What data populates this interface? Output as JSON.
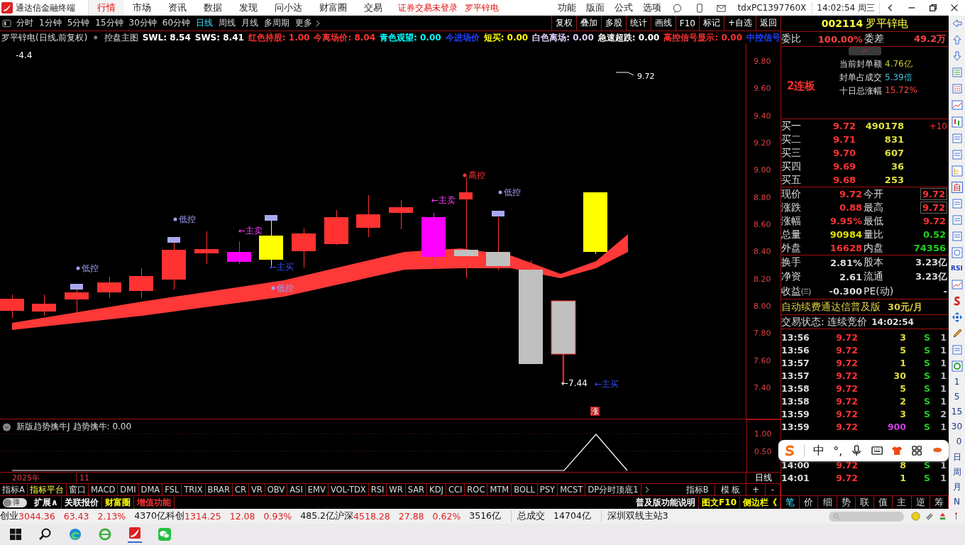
{
  "title_bar": {
    "app_name": "通达信金融终端",
    "menu": [
      {
        "label": "行情",
        "selected": true
      },
      {
        "label": "市场",
        "selected": false
      },
      {
        "label": "资讯",
        "selected": false
      },
      {
        "label": "数据",
        "selected": false
      },
      {
        "label": "发现",
        "selected": false
      },
      {
        "label": "问小达",
        "selected": false
      },
      {
        "label": "财富圈",
        "selected": false
      },
      {
        "label": "交易",
        "selected": false
      }
    ],
    "login_notice": "证券交易未登录",
    "stock_name": "罗平锌电",
    "right_menu": [
      "功能",
      "版面",
      "公式",
      "选项"
    ],
    "user": "tdxPC1397760X",
    "time": "14:02:54 周三"
  },
  "period_tabs": [
    {
      "label": "分时",
      "selected": false
    },
    {
      "label": "1分钟",
      "selected": false
    },
    {
      "label": "5分钟",
      "selected": false
    },
    {
      "label": "15分钟",
      "selected": false
    },
    {
      "label": "30分钟",
      "selected": false
    },
    {
      "label": "60分钟",
      "selected": false
    },
    {
      "label": "日线",
      "selected": true
    },
    {
      "label": "周线",
      "selected": false
    },
    {
      "label": "月线",
      "selected": false
    },
    {
      "label": "多周期",
      "selected": false
    },
    {
      "label": "更多",
      "selected": false
    }
  ],
  "chart_tools": [
    "复权",
    "叠加",
    "多股",
    "统计",
    "画线",
    "F10",
    "标记",
    "+自选",
    "返回"
  ],
  "indicator_line": {
    "title": "罗平锌电(日线,前复权)",
    "formula": "控盘主图",
    "values": [
      {
        "text": "SWL: 8.54",
        "color": "#ffffff"
      },
      {
        "text": "SWS: 8.41",
        "color": "#ffffff"
      },
      {
        "text": "红色持股: 1.00",
        "color": "#ff3232"
      },
      {
        "text": "今离场价: 8.04",
        "color": "#ff3232"
      },
      {
        "text": "青色观望: 0.00",
        "color": "#00ffff"
      },
      {
        "text": "今进场价",
        "color": "#2040ff"
      },
      {
        "text": "短买: 0.00",
        "color": "#ffff00"
      },
      {
        "text": "白色离场: 0.00",
        "color": "#e0d0ff"
      },
      {
        "text": "急速超跌: 0.00",
        "color": "#ffffff"
      },
      {
        "text": "高控信号显示: 0.00",
        "color": "#ff3232"
      },
      {
        "text": "中控信号",
        "color": "#2040ff"
      }
    ]
  },
  "price_ticks": [
    "9.80",
    "9.60",
    "9.40",
    "9.20",
    "9.00",
    "8.80",
    "8.60",
    "8.40",
    "8.20",
    "8.00",
    "7.80",
    "7.60",
    "7.40"
  ],
  "annotations": [
    {
      "text": "-4.4",
      "kind": "value"
    },
    {
      "text": "低控",
      "kind": "low-control"
    },
    {
      "text": "低控",
      "kind": "low-control"
    },
    {
      "text": "低控",
      "kind": "low-control"
    },
    {
      "text": "高控",
      "kind": "high-control"
    },
    {
      "text": "低控",
      "kind": "low-control"
    },
    {
      "text": "←主卖",
      "kind": "main-sell"
    },
    {
      "text": "←主卖",
      "kind": "main-sell"
    },
    {
      "text": "←主买",
      "kind": "main-buy"
    },
    {
      "text": "←主买",
      "kind": "main-buy"
    },
    {
      "text": "←7.44",
      "kind": "value"
    },
    {
      "text": "9.72",
      "kind": "high-mark"
    },
    {
      "text": "涨",
      "kind": "badge"
    }
  ],
  "sub_chart": {
    "title": "新版趋势擒牛J",
    "reading": "趋势擒牛: 0.00",
    "ticks": [
      "1.00",
      "0.50"
    ]
  },
  "date_axis": [
    "2025年",
    "11"
  ],
  "period_label": "日线",
  "indicator_tabs": [
    {
      "label": "指标A",
      "selected": false
    },
    {
      "label": "指标平台",
      "selected": true
    },
    {
      "label": "窗口",
      "selected": false
    },
    {
      "label": "MACD",
      "selected": false
    },
    {
      "label": "DMI",
      "selected": false
    },
    {
      "label": "DMA",
      "selected": false
    },
    {
      "label": "FSL",
      "selected": false
    },
    {
      "label": "TRIX",
      "selected": false
    },
    {
      "label": "BRAR",
      "selected": false
    },
    {
      "label": "CR",
      "selected": false
    },
    {
      "label": "VR",
      "selected": false
    },
    {
      "label": "OBV",
      "selected": false
    },
    {
      "label": "ASI",
      "selected": false
    },
    {
      "label": "EMV",
      "selected": false
    },
    {
      "label": "VOL-TDX",
      "selected": false
    },
    {
      "label": "RSI",
      "selected": false
    },
    {
      "label": "WR",
      "selected": false
    },
    {
      "label": "SAR",
      "selected": false
    },
    {
      "label": "KDJ",
      "selected": false
    },
    {
      "label": "CCI",
      "selected": false
    },
    {
      "label": "ROC",
      "selected": false
    },
    {
      "label": "MTM",
      "selected": false
    },
    {
      "label": "BOLL",
      "selected": false
    },
    {
      "label": "PSY",
      "selected": false
    },
    {
      "label": "MCST",
      "selected": false
    },
    {
      "label": "DP分时顶底1",
      "selected": false
    }
  ],
  "indicator_tabs_right": [
    "指标B",
    "模 板",
    "+",
    "-"
  ],
  "function_row": {
    "toggle_label": "弹",
    "toggle_on": false,
    "left": [
      {
        "text": "扩展∧",
        "color": "#ffffff"
      },
      {
        "text": "关联报价",
        "color": "#ffffff"
      },
      {
        "text": "财富圈",
        "color": "#ffff00"
      },
      {
        "text": "增值功能",
        "color": "#ff3232"
      }
    ],
    "right": [
      {
        "text": "普及版功能说明",
        "color": "#ffffff"
      },
      {
        "text": "图文F10",
        "color": "#ffff00"
      },
      {
        "text": "侧边栏《",
        "color": "#ffff00"
      }
    ]
  },
  "quote_panel": {
    "code": "002114",
    "name": "罗平锌电",
    "ratio": {
      "label": "委比",
      "value": "100.00%",
      "diff_label": "委差",
      "diff": "49.2万"
    },
    "seal": {
      "streak": "2连板",
      "lines": [
        {
          "label": "当前封单额",
          "value": "4.76亿",
          "color": "#c8c832"
        },
        {
          "label": "封单占成交",
          "value": "5.39倍",
          "color": "#40c0e0"
        },
        {
          "label": "十日总涨幅",
          "value": "15.72%",
          "color": "#ff4040"
        }
      ]
    },
    "bids": [
      {
        "label": "买一",
        "price": "9.72",
        "volume": "490178",
        "change": "+10"
      },
      {
        "label": "买二",
        "price": "9.71",
        "volume": "831"
      },
      {
        "label": "买三",
        "price": "9.70",
        "volume": "607"
      },
      {
        "label": "买四",
        "price": "9.69",
        "volume": "36"
      },
      {
        "label": "买五",
        "price": "9.68",
        "volume": "253"
      }
    ],
    "stats": [
      {
        "left": {
          "label": "现价",
          "value": "9.72",
          "color": "#ff3232"
        },
        "right": {
          "label": "今开",
          "value": "9.72",
          "color": "#ff3232",
          "boxed": true
        }
      },
      {
        "left": {
          "label": "涨跌",
          "value": "0.88",
          "color": "#ff3232"
        },
        "right": {
          "label": "最高",
          "value": "9.72",
          "color": "#ff3232",
          "boxed": true
        }
      },
      {
        "left": {
          "label": "涨幅",
          "value": "9.95%",
          "color": "#ff3232"
        },
        "right": {
          "label": "最低",
          "value": "9.72",
          "color": "#ff3232",
          "boxed": false
        }
      },
      {
        "left": {
          "label": "总量",
          "value": "90984",
          "color": "#e0e000"
        },
        "right": {
          "label": "量比",
          "value": "0.52",
          "color": "#20d020",
          "boxed": false
        }
      },
      {
        "left": {
          "label": "外盘",
          "value": "16628",
          "color": "#ff3232"
        },
        "right": {
          "label": "内盘",
          "value": "74356",
          "color": "#20d020",
          "boxed": false
        }
      }
    ],
    "fundamentals": [
      {
        "l1": "换手",
        "v1": "2.81%",
        "l2": "股本",
        "v2": "3.23亿"
      },
      {
        "l1": "净资",
        "v1": "2.61",
        "l2": "流通",
        "v2": "3.23亿"
      },
      {
        "l1": "收益㈢",
        "v1": "-0.300",
        "l2": "PE(动)",
        "v2": "-"
      }
    ],
    "ad": {
      "text": "自动续费通达信普及版",
      "price": "30元/月"
    },
    "trade_status": {
      "label": "交易状态: 连续竞价",
      "time": "14:02:54"
    },
    "ticks": [
      {
        "time": "13:56",
        "price": "9.72",
        "volume": "3",
        "side": "S",
        "count": "1",
        "large": false
      },
      {
        "time": "13:56",
        "price": "9.72",
        "volume": "5",
        "side": "S",
        "count": "1",
        "large": false
      },
      {
        "time": "13:57",
        "price": "9.72",
        "volume": "1",
        "side": "S",
        "count": "1",
        "large": false
      },
      {
        "time": "13:57",
        "price": "9.72",
        "volume": "30",
        "side": "S",
        "count": "1",
        "large": false
      },
      {
        "time": "13:58",
        "price": "9.72",
        "volume": "5",
        "side": "S",
        "count": "1",
        "large": false
      },
      {
        "time": "13:58",
        "price": "9.72",
        "volume": "2",
        "side": "S",
        "count": "1",
        "large": false
      },
      {
        "time": "13:59",
        "price": "9.72",
        "volume": "3",
        "side": "S",
        "count": "2",
        "large": false
      },
      {
        "time": "13:59",
        "price": "9.72",
        "volume": "900",
        "side": "S",
        "count": "1",
        "large": true
      },
      {
        "time": "14:00",
        "price": "9.72",
        "volume": "8",
        "side": "S",
        "count": "1",
        "large": false
      },
      {
        "time": "14:01",
        "price": "9.72",
        "volume": "1",
        "side": "S",
        "count": "1",
        "large": false
      }
    ],
    "tabs": [
      {
        "label": "笔",
        "selected": true
      },
      {
        "label": "价",
        "selected": false
      },
      {
        "label": "细",
        "selected": false
      },
      {
        "label": "势",
        "selected": false
      },
      {
        "label": "联",
        "selected": false
      },
      {
        "label": "值",
        "selected": false
      },
      {
        "label": "主",
        "selected": false
      },
      {
        "label": "逆",
        "selected": false
      },
      {
        "label": "筹",
        "selected": false
      }
    ]
  },
  "sidebar_labels": [
    "自",
    "RSI",
    "1",
    "5",
    "15",
    "30",
    "0",
    "日",
    "周",
    "月",
    "N"
  ],
  "status_bar": {
    "indices": [
      {
        "name": "创业",
        "value": "3044.36",
        "change": "63.43",
        "pct": "2.13%",
        "amount": "4370亿"
      },
      {
        "name": "科创",
        "value": "1314.25",
        "change": "12.08",
        "pct": "0.93%",
        "amount": "485.2亿"
      },
      {
        "name": "沪深",
        "value": "4518.28",
        "change": "27.88",
        "pct": "0.62%",
        "amount": "3516亿"
      }
    ],
    "total_label": "总成交",
    "total": "14704亿",
    "server": "深圳双线主站3"
  },
  "ime_bar": {
    "chinese": "中",
    "punct": "°,"
  }
}
